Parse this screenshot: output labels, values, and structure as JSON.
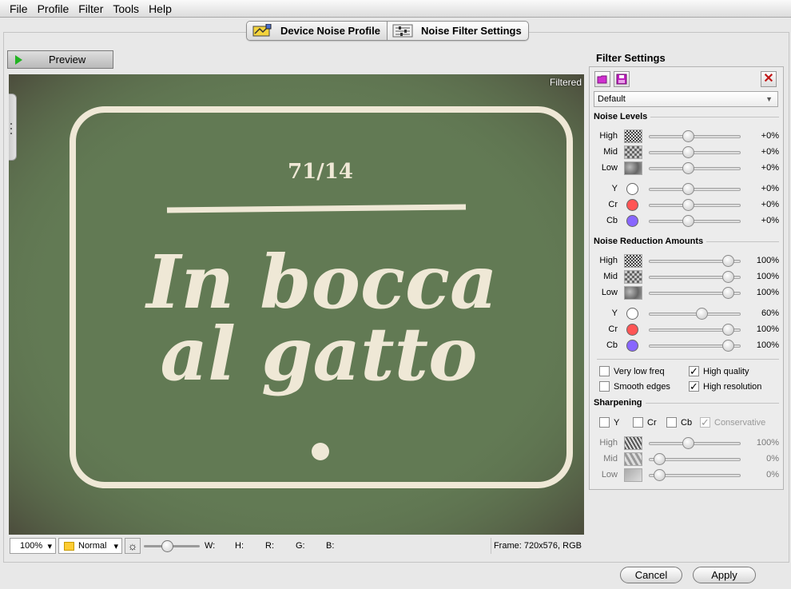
{
  "menu": [
    "File",
    "Profile",
    "Filter",
    "Tools",
    "Help"
  ],
  "tabs": [
    {
      "label": "Device Noise Profile",
      "icon": "device-profile-icon"
    },
    {
      "label": "Noise Filter Settings",
      "icon": "filter-settings-icon"
    }
  ],
  "preview": {
    "button_label": "Preview",
    "overlay_label": "Filtered",
    "image": {
      "number": "71/14",
      "line1": "In bocca",
      "line2": "al gatto"
    }
  },
  "status": {
    "zoom": "100%",
    "mode": "Normal",
    "brightness_level": 0.4,
    "w_label": "W:",
    "h_label": "H:",
    "r_label": "R:",
    "g_label": "G:",
    "b_label": "B:",
    "frame": "Frame: 720x576, RGB"
  },
  "filter": {
    "title": "Filter Settings",
    "preset": "Default",
    "noise_levels": {
      "title": "Noise Levels",
      "rows": [
        {
          "label": "High",
          "value": "+0%",
          "pos": 0.42
        },
        {
          "label": "Mid",
          "value": "+0%",
          "pos": 0.42
        },
        {
          "label": "Low",
          "value": "+0%",
          "pos": 0.42
        },
        {
          "label": "Y",
          "value": "+0%",
          "pos": 0.42
        },
        {
          "label": "Cr",
          "value": "+0%",
          "pos": 0.42
        },
        {
          "label": "Cb",
          "value": "+0%",
          "pos": 0.42
        }
      ]
    },
    "reduction": {
      "title": "Noise Reduction Amounts",
      "rows": [
        {
          "label": "High",
          "value": "100%",
          "pos": 0.92
        },
        {
          "label": "Mid",
          "value": "100%",
          "pos": 0.92
        },
        {
          "label": "Low",
          "value": "100%",
          "pos": 0.92
        },
        {
          "label": "Y",
          "value": "60%",
          "pos": 0.59
        },
        {
          "label": "Cr",
          "value": "100%",
          "pos": 0.92
        },
        {
          "label": "Cb",
          "value": "100%",
          "pos": 0.92
        }
      ]
    },
    "options": {
      "very_low_freq": "Very low freq",
      "high_quality": "High quality",
      "smooth_edges": "Smooth edges",
      "high_resolution": "High resolution"
    },
    "sharpening": {
      "title": "Sharpening",
      "y": "Y",
      "cr": "Cr",
      "cb": "Cb",
      "conservative": "Conservative",
      "rows": [
        {
          "label": "High",
          "value": "100%",
          "pos": 0.42
        },
        {
          "label": "Mid",
          "value": "0%",
          "pos": 0.06
        },
        {
          "label": "Low",
          "value": "0%",
          "pos": 0.06
        }
      ]
    }
  },
  "colors": {
    "y_swatch": "#ffffff",
    "cr_swatch": "#ff5555",
    "cb_swatch": "#8866ff",
    "screen_bg": "#627a54"
  },
  "buttons": {
    "cancel": "Cancel",
    "apply": "Apply"
  }
}
